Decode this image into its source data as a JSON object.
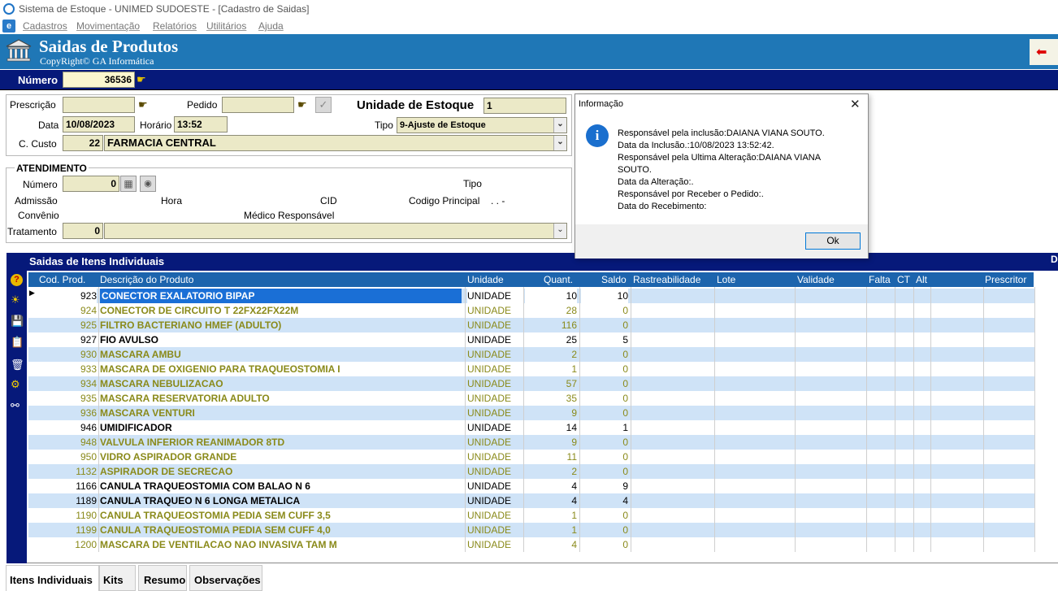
{
  "window": {
    "title": "Sistema de Estoque - UNIMED SUDOESTE - [Cadastro de Saidas]"
  },
  "menu": {
    "items": [
      "Cadastros",
      "Movimentação",
      "Relatórios",
      "Utilitários",
      "Ajuda"
    ]
  },
  "header": {
    "title": "Saidas de Produtos",
    "subtitle": "CopyRight© GA Informática"
  },
  "numero": {
    "label": "Número",
    "value": "36536"
  },
  "form": {
    "prescricao_label": "Prescrição",
    "pedido_label": "Pedido",
    "unidade_label": "Unidade de Estoque",
    "unidade_value": "1",
    "data_label": "Data",
    "data_value": "10/08/2023",
    "horario_label": "Horário",
    "horario_value": "13:52",
    "tipo_label": "Tipo",
    "tipo_value": "9-Ajuste de Estoque",
    "custo_label": "C. Custo",
    "custo_code": "22",
    "custo_name": "FARMACIA CENTRAL"
  },
  "atendimento": {
    "title": "ATENDIMENTO",
    "numero_label": "Número",
    "numero_value": "0",
    "tipo_label": "Tipo",
    "admissao_label": "Admissão",
    "hora_label": "Hora",
    "cid_label": "CID",
    "codigo_label": "Codigo Principal",
    "codigo_value": ". . -",
    "convenio_label": "Convênio",
    "medico_label": "Médico Responsável",
    "tratamento_label": "Tratamento",
    "tratamento_value": "0"
  },
  "dialog": {
    "title": "Informação",
    "lines": [
      "Responsável pela inclusão:DAIANA VIANA SOUTO.",
      "Data da Inclusão.:10/08/2023 13:52:42.",
      "Responsável pela Ultima Alteração:DAIANA VIANA",
      "SOUTO.",
      "Data da Alteração:.",
      "Responsável por Receber o Pedido:.",
      "Data do Recebimento:"
    ],
    "ok_label": "Ok"
  },
  "grid": {
    "title": "Saidas de Itens Individuais",
    "right_label": "D",
    "columns": [
      "Cod. Prod.",
      "Descrição do Produto",
      "Unidade",
      "Quant.",
      "Saldo",
      "Rastreabilidade",
      "Lote",
      "Validade",
      "Falta",
      "CT",
      "Alt",
      "Prescritor"
    ],
    "rows": [
      {
        "cod": "923",
        "desc": "CONECTOR EXALATORIO BIPAP",
        "un": "UNIDADE",
        "qt": "10",
        "saldo": "10",
        "style": "sel"
      },
      {
        "cod": "924",
        "desc": "CONECTOR DE CIRCUITO T 22FX22FX22M",
        "un": "UNIDADE",
        "qt": "28",
        "saldo": "0",
        "style": "olive"
      },
      {
        "cod": "925",
        "desc": "FILTRO BACTERIANO HMEF (ADULTO)",
        "un": "UNIDADE",
        "qt": "116",
        "saldo": "0",
        "style": "olive"
      },
      {
        "cod": "927",
        "desc": "FIO AVULSO",
        "un": "UNIDADE",
        "qt": "25",
        "saldo": "5",
        "style": "black"
      },
      {
        "cod": "930",
        "desc": "MASCARA AMBU",
        "un": "UNIDADE",
        "qt": "2",
        "saldo": "0",
        "style": "olive"
      },
      {
        "cod": "933",
        "desc": "MASCARA DE OXIGENIO PARA TRAQUEOSTOMIA I",
        "un": "UNIDADE",
        "qt": "1",
        "saldo": "0",
        "style": "olive"
      },
      {
        "cod": "934",
        "desc": "MASCARA NEBULIZACAO",
        "un": "UNIDADE",
        "qt": "57",
        "saldo": "0",
        "style": "olive"
      },
      {
        "cod": "935",
        "desc": "MASCARA RESERVATORIA ADULTO",
        "un": "UNIDADE",
        "qt": "35",
        "saldo": "0",
        "style": "olive"
      },
      {
        "cod": "936",
        "desc": "MASCARA VENTURI",
        "un": "UNIDADE",
        "qt": "9",
        "saldo": "0",
        "style": "olive"
      },
      {
        "cod": "946",
        "desc": "UMIDIFICADOR",
        "un": "UNIDADE",
        "qt": "14",
        "saldo": "1",
        "style": "black"
      },
      {
        "cod": "948",
        "desc": "VALVULA INFERIOR REANIMADOR 8TD",
        "un": "UNIDADE",
        "qt": "9",
        "saldo": "0",
        "style": "olive"
      },
      {
        "cod": "950",
        "desc": "VIDRO ASPIRADOR GRANDE",
        "un": "UNIDADE",
        "qt": "11",
        "saldo": "0",
        "style": "olive"
      },
      {
        "cod": "1132",
        "desc": "ASPIRADOR DE SECRECAO",
        "un": "UNIDADE",
        "qt": "2",
        "saldo": "0",
        "style": "olive"
      },
      {
        "cod": "1166",
        "desc": "CANULA TRAQUEOSTOMIA COM BALAO N 6",
        "un": "UNIDADE",
        "qt": "4",
        "saldo": "9",
        "style": "black"
      },
      {
        "cod": "1189",
        "desc": "CANULA TRAQUEO N 6 LONGA METALICA",
        "un": "UNIDADE",
        "qt": "4",
        "saldo": "4",
        "style": "black"
      },
      {
        "cod": "1190",
        "desc": "CANULA TRAQUEOSTOMIA PEDIA SEM CUFF 3,5",
        "un": "UNIDADE",
        "qt": "1",
        "saldo": "0",
        "style": "olive"
      },
      {
        "cod": "1199",
        "desc": "CANULA TRAQUEOSTOMIA PEDIA SEM CUFF 4,0",
        "un": "UNIDADE",
        "qt": "1",
        "saldo": "0",
        "style": "olive"
      },
      {
        "cod": "1200",
        "desc": "MASCARA DE VENTILACAO NAO INVASIVA TAM M",
        "un": "UNIDADE",
        "qt": "4",
        "saldo": "0",
        "style": "olive"
      }
    ]
  },
  "tabs": [
    "Itens Individuais",
    "Kits",
    "Resumo",
    "Observações"
  ],
  "colors": {
    "header_blue": "#1f77b6",
    "navy": "#06197a",
    "olive_text": "#8a8a1a",
    "selected_row": "#1a6fd6",
    "row_alt": "#cfe3f7",
    "field_bg": "#ebe9c7"
  }
}
